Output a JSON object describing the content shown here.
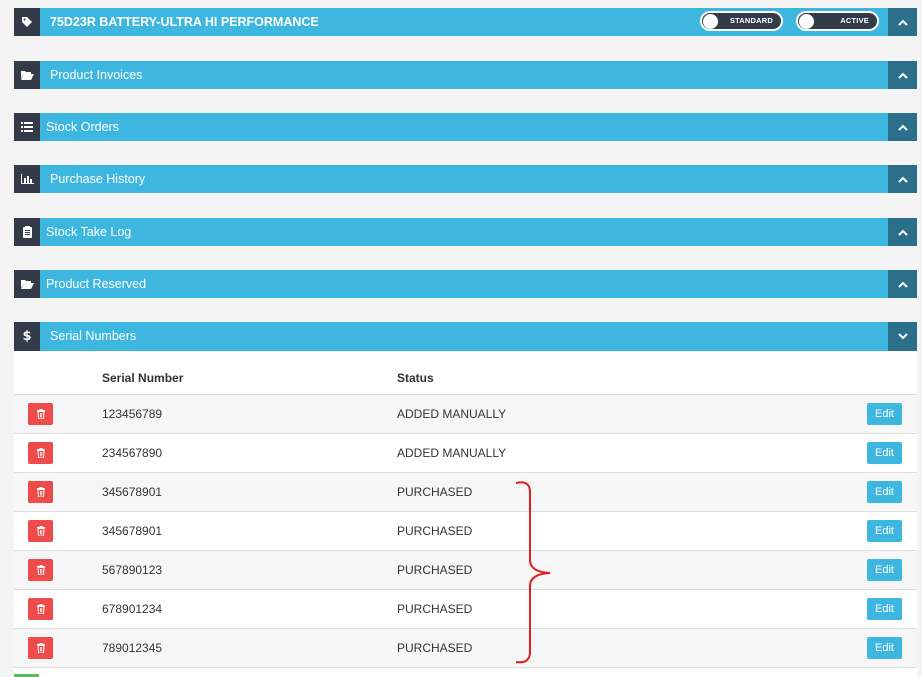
{
  "product": {
    "title": "75D23R BATTERY-ULTRA HI PERFORMANCE",
    "toggle_standard": "STANDARD",
    "toggle_active": "ACTIVE"
  },
  "sections": {
    "invoices": "Product Invoices",
    "stock_orders": "Stock Orders",
    "purchase_history": "Purchase History",
    "stock_take_log": "Stock Take Log",
    "product_reserved": "Product Reserved",
    "serial_numbers": "Serial Numbers"
  },
  "serial_table": {
    "col_serial": "Serial Number",
    "col_status": "Status",
    "edit_label": "Edit",
    "rows": [
      {
        "serial": "123456789",
        "status": "ADDED MANUALLY"
      },
      {
        "serial": "234567890",
        "status": "ADDED MANUALLY"
      },
      {
        "serial": "345678901",
        "status": "PURCHASED"
      },
      {
        "serial": "345678901",
        "status": "PURCHASED"
      },
      {
        "serial": "567890123",
        "status": "PURCHASED"
      },
      {
        "serial": "678901234",
        "status": "PURCHASED"
      },
      {
        "serial": "789012345",
        "status": "PURCHASED"
      }
    ]
  },
  "colors": {
    "header_blue": "#3eb7e0",
    "icon_dark": "#333a48",
    "chevron_dark": "#2b6f8a",
    "delete_red": "#ee4b4b",
    "annotation_red": "#e02020"
  }
}
